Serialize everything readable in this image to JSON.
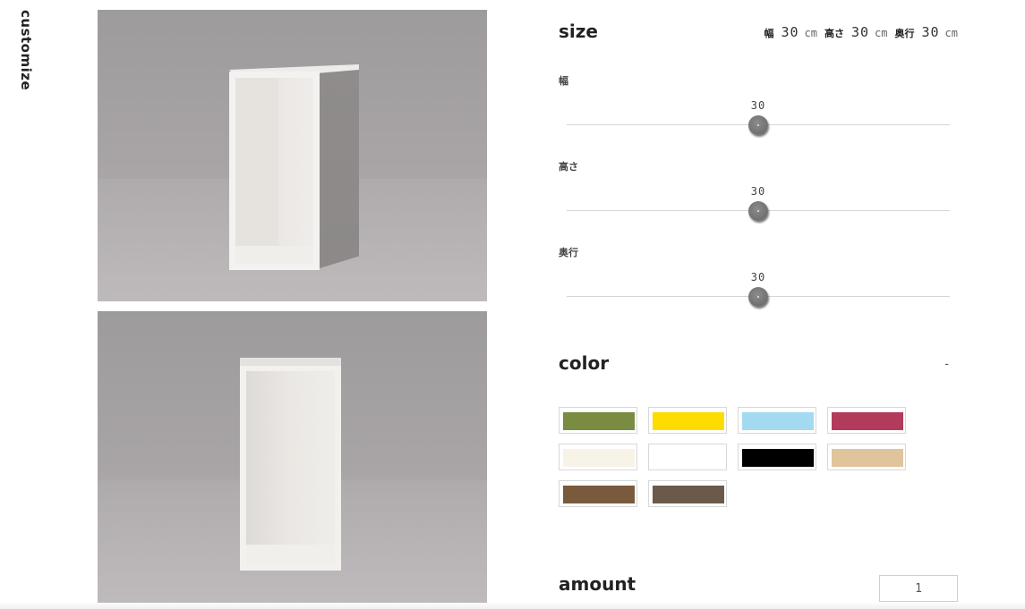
{
  "sidebar": {
    "title": "customize"
  },
  "gallery": {
    "images": [
      {
        "name": "cube-box-angled-photo"
      },
      {
        "name": "cube-box-front-photo"
      }
    ]
  },
  "size": {
    "title": "size",
    "summary": {
      "width_label": "幅",
      "width_value": "30",
      "height_label": "高さ",
      "height_value": "30",
      "depth_label": "奥行",
      "depth_value": "30",
      "unit": "cm"
    },
    "sliders": [
      {
        "label": "幅",
        "value": "30",
        "level": 0.5
      },
      {
        "label": "高さ",
        "value": "30",
        "level": 0.5
      },
      {
        "label": "奥行",
        "value": "30",
        "level": 0.5
      }
    ]
  },
  "color": {
    "title": "color",
    "toggle": "-",
    "swatches": [
      {
        "color": "#7a8c41",
        "name": "olive-green"
      },
      {
        "color": "#ffdc00",
        "name": "yellow"
      },
      {
        "color": "#a3daf0",
        "name": "light-blue"
      },
      {
        "color": "#b23b5c",
        "name": "raspberry"
      },
      {
        "color": "#f7f3e6",
        "name": "cream"
      },
      {
        "color": "#ffffff",
        "name": "white"
      },
      {
        "color": "#000000",
        "name": "black"
      },
      {
        "color": "#e0c49c",
        "name": "beige"
      },
      {
        "color": "#7a5a3c",
        "name": "brown"
      },
      {
        "color": "#6b5a4b",
        "name": "dark-brown"
      }
    ]
  },
  "amount": {
    "title": "amount",
    "value": "1"
  }
}
